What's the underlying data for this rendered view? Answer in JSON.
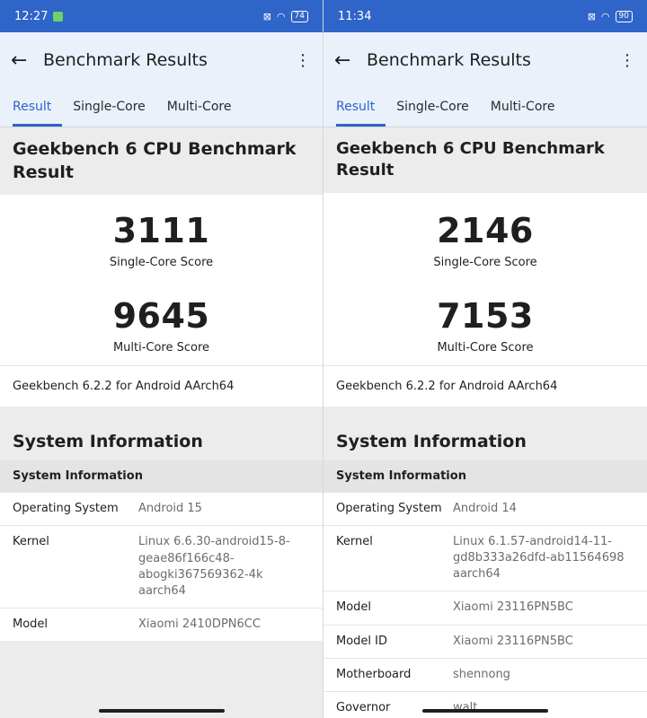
{
  "left": {
    "status": {
      "time": "12:27",
      "battery": "74"
    },
    "appbar": {
      "back_icon": "←",
      "title": "Benchmark Results",
      "more_icon": "⋮"
    },
    "tabs": [
      "Result",
      "Single-Core",
      "Multi-Core"
    ],
    "headline": "Geekbench 6 CPU Benchmark Result",
    "scores": [
      {
        "value": "3111",
        "label": "Single-Core Score"
      },
      {
        "value": "9645",
        "label": "Multi-Core Score"
      }
    ],
    "version": "Geekbench 6.2.2 for Android AArch64",
    "sysinfo_title": "System Information",
    "sysinfo_subhead": "System Information",
    "rows": [
      {
        "k": "Operating System",
        "v": "Android 15"
      },
      {
        "k": "Kernel",
        "v": "Linux 6.6.30-android15-8-geae86f166c48-abogki367569362-4k aarch64"
      },
      {
        "k": "Model",
        "v": "Xiaomi 2410DPN6CC"
      }
    ]
  },
  "right": {
    "status": {
      "time": "11:34",
      "battery": "90"
    },
    "appbar": {
      "back_icon": "←",
      "title": "Benchmark Results",
      "more_icon": "⋮"
    },
    "tabs": [
      "Result",
      "Single-Core",
      "Multi-Core"
    ],
    "headline": "Geekbench 6 CPU Benchmark Result",
    "scores": [
      {
        "value": "2146",
        "label": "Single-Core Score"
      },
      {
        "value": "7153",
        "label": "Multi-Core Score"
      }
    ],
    "version": "Geekbench 6.2.2 for Android AArch64",
    "sysinfo_title": "System Information",
    "sysinfo_subhead": "System Information",
    "rows": [
      {
        "k": "Operating System",
        "v": "Android 14"
      },
      {
        "k": "Kernel",
        "v": "Linux 6.1.57-android14-11-gd8b333a26dfd-ab11564698 aarch64"
      },
      {
        "k": "Model",
        "v": "Xiaomi 23116PN5BC"
      },
      {
        "k": "Model ID",
        "v": "Xiaomi 23116PN5BC"
      },
      {
        "k": "Motherboard",
        "v": "shennong"
      },
      {
        "k": "Governor",
        "v": "walt"
      }
    ]
  }
}
